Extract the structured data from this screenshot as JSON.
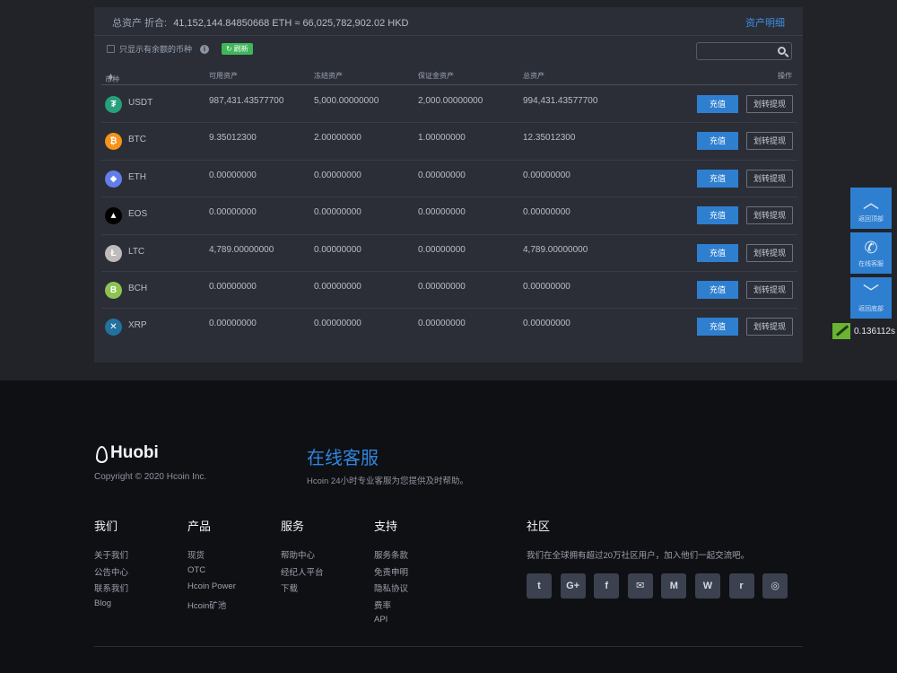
{
  "summary": {
    "label": "总资产 折合:",
    "value": "41,152,144.84850668 ETH ≈ 66,025,782,902.02 HKD",
    "detail_link": "资产明细"
  },
  "filter": {
    "checkbox_label": "只显示有余额的币种",
    "info_icon": "info-icon",
    "refresh_label": "刷新"
  },
  "search": {
    "placeholder": ""
  },
  "table": {
    "headers": {
      "coin": "币种",
      "available": "可用资产",
      "frozen": "冻结资产",
      "margin": "保证金资产",
      "total": "总资产",
      "action": "操作"
    },
    "deposit_label": "充值",
    "transfer_label": "划转提现",
    "rows": [
      {
        "coin": "USDT",
        "icon": "₮",
        "color": "#26a17b",
        "available": "987,431.43577700",
        "frozen": "5,000.00000000",
        "margin": "2,000.00000000",
        "total": "994,431.43577700"
      },
      {
        "coin": "BTC",
        "icon": "₿",
        "color": "#f7931a",
        "available": "9.35012300",
        "frozen": "2.00000000",
        "margin": "1.00000000",
        "total": "12.35012300"
      },
      {
        "coin": "ETH",
        "icon": "◆",
        "color": "#627eea",
        "available": "0.00000000",
        "frozen": "0.00000000",
        "margin": "0.00000000",
        "total": "0.00000000"
      },
      {
        "coin": "EOS",
        "icon": "▲",
        "color": "#000000",
        "available": "0.00000000",
        "frozen": "0.00000000",
        "margin": "0.00000000",
        "total": "0.00000000"
      },
      {
        "coin": "LTC",
        "icon": "Ł",
        "color": "#bfbbbb",
        "available": "4,789.00000000",
        "frozen": "0.00000000",
        "margin": "0.00000000",
        "total": "4,789.00000000"
      },
      {
        "coin": "BCH",
        "icon": "B",
        "color": "#8dc351",
        "available": "0.00000000",
        "frozen": "0.00000000",
        "margin": "0.00000000",
        "total": "0.00000000"
      },
      {
        "coin": "XRP",
        "icon": "✕",
        "color": "#23719e",
        "available": "0.00000000",
        "frozen": "0.00000000",
        "margin": "0.00000000",
        "total": "0.00000000"
      }
    ]
  },
  "side_tools": {
    "back_top": "返回顶部",
    "online_service": "在线客服",
    "back_bottom": "返回底部",
    "timer": "0.136112s"
  },
  "footer": {
    "logo_text": "Huobi",
    "copyright": "Copyright © 2020 Hcoin Inc.",
    "cs_title": "在线客服",
    "cs_desc": "Hcoin 24小时专业客服为您提供及时帮助。",
    "columns": [
      {
        "title": "我们",
        "links": [
          "关于我们",
          "公告中心",
          "联系我们",
          "Blog"
        ]
      },
      {
        "title": "产品",
        "links": [
          "现货",
          "OTC",
          "Hcoin Power",
          "Hcoin矿池"
        ]
      },
      {
        "title": "服务",
        "links": [
          "帮助中心",
          "经纪人平台",
          "下载"
        ]
      },
      {
        "title": "支持",
        "links": [
          "服务条款",
          "免责申明",
          "隐私协议",
          "费率",
          "API"
        ]
      }
    ],
    "community": {
      "title": "社区",
      "desc": "我们在全球拥有超过20万社区用户，加入他们一起交流吧。",
      "icons": [
        "twitter-icon",
        "google-plus-icon",
        "facebook-icon",
        "wechat-icon",
        "medium-icon",
        "weibo-icon",
        "reddit-icon",
        "instagram-icon"
      ],
      "glyphs": [
        "t",
        "G+",
        "f",
        "✉",
        "M",
        "W",
        "r",
        "◎"
      ]
    }
  }
}
